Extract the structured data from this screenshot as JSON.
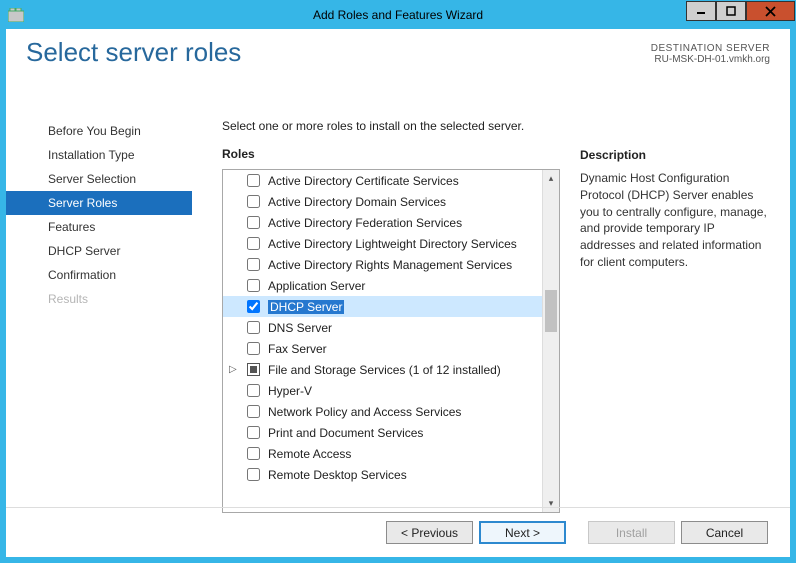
{
  "window": {
    "title": "Add Roles and Features Wizard"
  },
  "header": {
    "page_title": "Select server roles",
    "destination_label": "DESTINATION SERVER",
    "destination_value": "RU-MSK-DH-01.vmkh.org"
  },
  "nav": {
    "items": [
      {
        "label": "Before You Begin",
        "state": "normal"
      },
      {
        "label": "Installation Type",
        "state": "normal"
      },
      {
        "label": "Server Selection",
        "state": "normal"
      },
      {
        "label": "Server Roles",
        "state": "selected"
      },
      {
        "label": "Features",
        "state": "normal"
      },
      {
        "label": "DHCP Server",
        "state": "normal"
      },
      {
        "label": "Confirmation",
        "state": "normal"
      },
      {
        "label": "Results",
        "state": "disabled"
      }
    ]
  },
  "content": {
    "instruction": "Select one or more roles to install on the selected server.",
    "roles_label": "Roles",
    "description_label": "Description",
    "description_text": "Dynamic Host Configuration Protocol (DHCP) Server enables you to centrally configure, manage, and provide temporary IP addresses and related information for client computers.",
    "roles": [
      {
        "label": "Active Directory Certificate Services",
        "checked": false
      },
      {
        "label": "Active Directory Domain Services",
        "checked": false
      },
      {
        "label": "Active Directory Federation Services",
        "checked": false
      },
      {
        "label": "Active Directory Lightweight Directory Services",
        "checked": false
      },
      {
        "label": "Active Directory Rights Management Services",
        "checked": false
      },
      {
        "label": "Application Server",
        "checked": false
      },
      {
        "label": "DHCP Server",
        "checked": true,
        "selected": true
      },
      {
        "label": "DNS Server",
        "checked": false
      },
      {
        "label": "Fax Server",
        "checked": false
      },
      {
        "label": "File and Storage Services (1 of 12 installed)",
        "checked": "mixed",
        "expandable": true
      },
      {
        "label": "Hyper-V",
        "checked": false
      },
      {
        "label": "Network Policy and Access Services",
        "checked": false
      },
      {
        "label": "Print and Document Services",
        "checked": false
      },
      {
        "label": "Remote Access",
        "checked": false
      },
      {
        "label": "Remote Desktop Services",
        "checked": false
      }
    ]
  },
  "footer": {
    "previous": "< Previous",
    "next": "Next >",
    "install": "Install",
    "cancel": "Cancel"
  }
}
